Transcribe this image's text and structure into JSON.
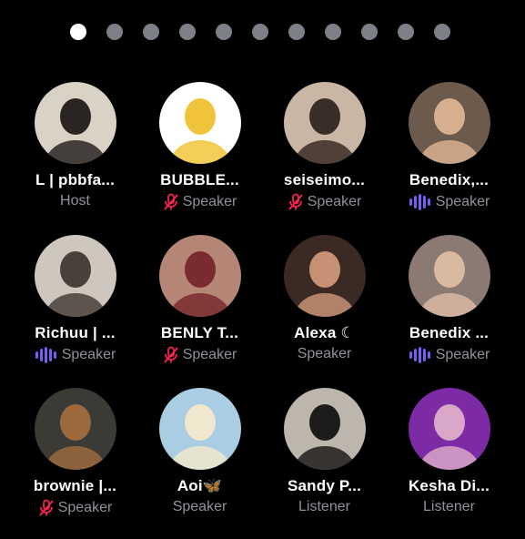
{
  "page_indicator": {
    "count": 11,
    "active_index": 0
  },
  "colors": {
    "mic_off": "#f4244f",
    "speaking": "#7a5cf5",
    "role_text": "#8f9399"
  },
  "participants": [
    {
      "name": "L | pbbfa...",
      "role": "Host",
      "mic": "none",
      "avatar_bg": "#d9d3c6",
      "avatar_fg": "#2a2522"
    },
    {
      "name": "BUBBLE...",
      "role": "Speaker",
      "mic": "muted",
      "avatar_bg": "#ffffff",
      "avatar_fg": "#f0c43a"
    },
    {
      "name": "seiseimo...",
      "role": "Speaker",
      "mic": "muted",
      "avatar_bg": "#c9b6a4",
      "avatar_fg": "#3a2c26"
    },
    {
      "name": "Benedix,...",
      "role": "Speaker",
      "mic": "speaking",
      "avatar_bg": "#6c5a4c",
      "avatar_fg": "#d8b08f"
    },
    {
      "name": "Richuu | ...",
      "role": "Speaker",
      "mic": "speaking",
      "avatar_bg": "#cfc7bd",
      "avatar_fg": "#4a403b"
    },
    {
      "name": "BENLY T...",
      "role": "Speaker",
      "mic": "muted",
      "avatar_bg": "#b58676",
      "avatar_fg": "#7a2b30"
    },
    {
      "name": "Alexa ☾",
      "role": "Speaker",
      "mic": "none",
      "avatar_bg": "#3b2a24",
      "avatar_fg": "#c79274"
    },
    {
      "name": "Benedix ...",
      "role": "Speaker",
      "mic": "speaking",
      "avatar_bg": "#8a7a72",
      "avatar_fg": "#d9b9a2"
    },
    {
      "name": "brownie |...",
      "role": "Speaker",
      "mic": "muted",
      "avatar_bg": "#3c3a35",
      "avatar_fg": "#9a6a3e"
    },
    {
      "name": "Aoi🦋",
      "role": "Speaker",
      "mic": "none",
      "avatar_bg": "#a9cde3",
      "avatar_fg": "#f0e7ce"
    },
    {
      "name": "Sandy P...",
      "role": "Listener",
      "mic": "none",
      "avatar_bg": "#bdb6ad",
      "avatar_fg": "#1e1c1b"
    },
    {
      "name": "Kesha Di...",
      "role": "Listener",
      "mic": "none",
      "avatar_bg": "#7d2aa5",
      "avatar_fg": "#d8a6c7"
    }
  ]
}
